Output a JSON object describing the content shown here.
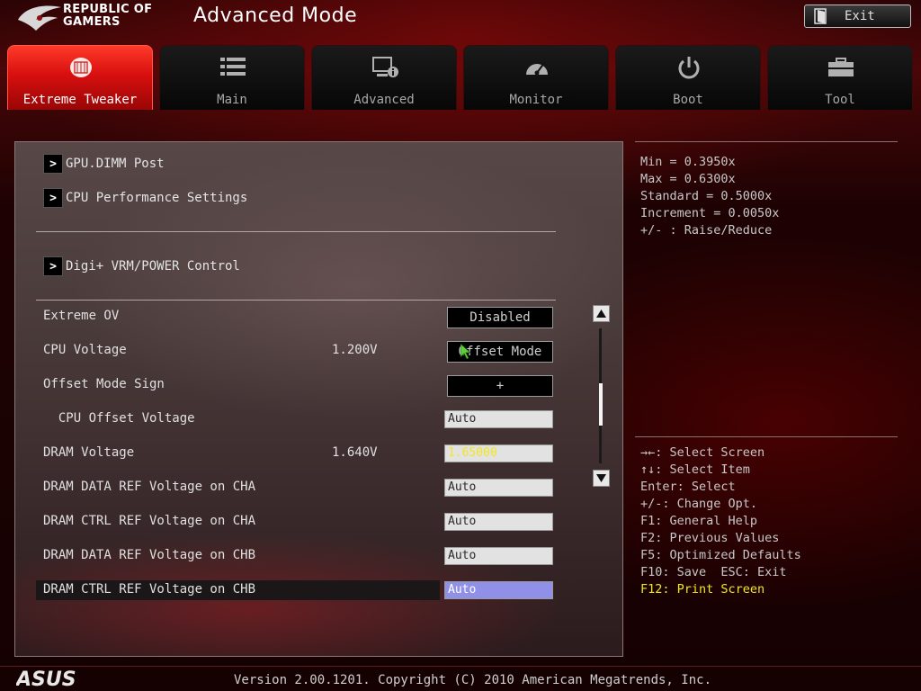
{
  "header": {
    "brand_line1": "REPUBLIC OF",
    "brand_line2": "GAMERS",
    "mode_title": "Advanced Mode",
    "exit_label": "Exit"
  },
  "tabs": [
    {
      "label": "Extreme Tweaker",
      "icon": "extreme-tweaker-icon",
      "active": true
    },
    {
      "label": "Main",
      "icon": "list-icon",
      "active": false
    },
    {
      "label": "Advanced",
      "icon": "advanced-icon",
      "active": false
    },
    {
      "label": "Monitor",
      "icon": "gauge-icon",
      "active": false
    },
    {
      "label": "Boot",
      "icon": "power-icon",
      "active": false
    },
    {
      "label": "Tool",
      "icon": "toolbox-icon",
      "active": false
    }
  ],
  "submenus": [
    {
      "label": "GPU.DIMM Post"
    },
    {
      "label": "CPU Performance Settings"
    },
    {
      "label": "Digi+ VRM/POWER Control"
    }
  ],
  "settings": [
    {
      "label": "Extreme OV",
      "value": "",
      "control": "Disabled"
    },
    {
      "label": "CPU Voltage",
      "value": "1.200V",
      "control": "Offset Mode"
    },
    {
      "label": "Offset Mode Sign",
      "value": "",
      "control": "+"
    },
    {
      "label": "  CPU Offset Voltage",
      "value": "",
      "control": "Auto"
    },
    {
      "label": "DRAM Voltage",
      "value": "1.640V",
      "control": "1.65000"
    },
    {
      "label": "DRAM DATA REF Voltage on CHA",
      "value": "",
      "control": "Auto"
    },
    {
      "label": "DRAM CTRL REF Voltage on CHA",
      "value": "",
      "control": "Auto"
    },
    {
      "label": "DRAM DATA REF Voltage on CHB",
      "value": "",
      "control": "Auto"
    },
    {
      "label": "DRAM CTRL REF Voltage on CHB",
      "value": "",
      "control": "Auto"
    }
  ],
  "info": [
    "Min = 0.3950x",
    "Max = 0.6300x",
    "Standard = 0.5000x",
    "Increment = 0.0050x",
    "+/- : Raise/Reduce"
  ],
  "keys": [
    "→←: Select Screen",
    "↑↓: Select Item",
    "Enter: Select",
    "+/-: Change Opt.",
    "F1: General Help",
    "F2: Previous Values",
    "F5: Optimized Defaults",
    "F10: Save  ESC: Exit",
    "F12: Print Screen"
  ],
  "footer": {
    "brand": "ASUS",
    "version": "Version 2.00.1201. Copyright (C) 2010 American Megatrends, Inc."
  },
  "colors": {
    "accent_red": "#d80f0f",
    "highlight": "#9090e8",
    "yellow_text": "#f2e81e"
  }
}
